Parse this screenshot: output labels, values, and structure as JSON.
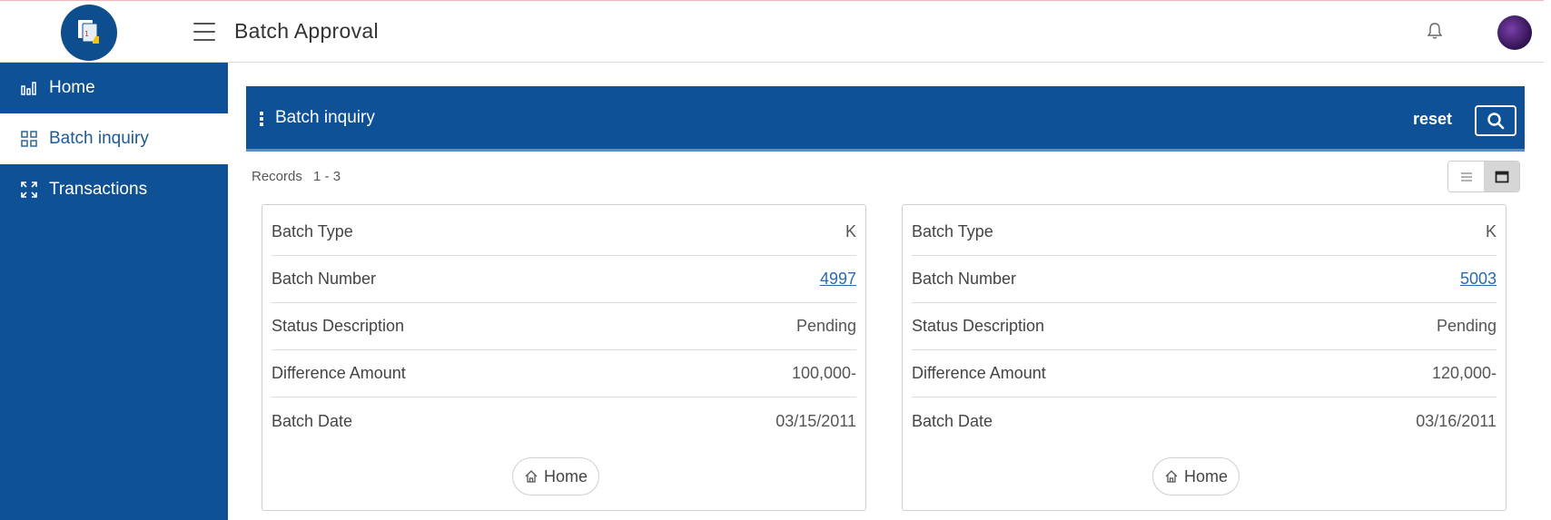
{
  "header": {
    "title": "Batch Approval",
    "logo_icon": "batch-approval-logo-icon",
    "menu_icon": "hamburger-icon",
    "notifications_icon": "bell-icon",
    "avatar_icon": "user-avatar"
  },
  "sidebar": {
    "items": [
      {
        "label": "Home",
        "icon": "bar-chart-icon",
        "active": false
      },
      {
        "label": "Batch inquiry",
        "icon": "grid-icon",
        "active": true
      },
      {
        "label": "Transactions",
        "icon": "expand-icon",
        "active": false
      }
    ]
  },
  "panel": {
    "title": "Batch inquiry",
    "reset_label": "reset",
    "search_icon": "search-icon",
    "records_label": "Records",
    "records_range": "1 - 3",
    "view_modes": [
      "list",
      "card"
    ],
    "selected_view": "card"
  },
  "cards": [
    {
      "rows": [
        {
          "label": "Batch Type",
          "value": "K",
          "link": false
        },
        {
          "label": "Batch Number",
          "value": "4997",
          "link": true
        },
        {
          "label": "Status Description",
          "value": "Pending",
          "link": false
        },
        {
          "label": "Difference Amount",
          "value": "100,000-",
          "link": false
        },
        {
          "label": "Batch Date",
          "value": "03/15/2011",
          "link": false
        }
      ],
      "home_label": "Home"
    },
    {
      "rows": [
        {
          "label": "Batch Type",
          "value": "K",
          "link": false
        },
        {
          "label": "Batch Number",
          "value": "5003",
          "link": true
        },
        {
          "label": "Status Description",
          "value": "Pending",
          "link": false
        },
        {
          "label": "Difference Amount",
          "value": "120,000-",
          "link": false
        },
        {
          "label": "Batch Date",
          "value": "03/16/2011",
          "link": false
        }
      ],
      "home_label": "Home"
    }
  ],
  "colors": {
    "primary": "#0e5196",
    "link": "#2a6ab0",
    "active_text": "#1e5a96"
  }
}
